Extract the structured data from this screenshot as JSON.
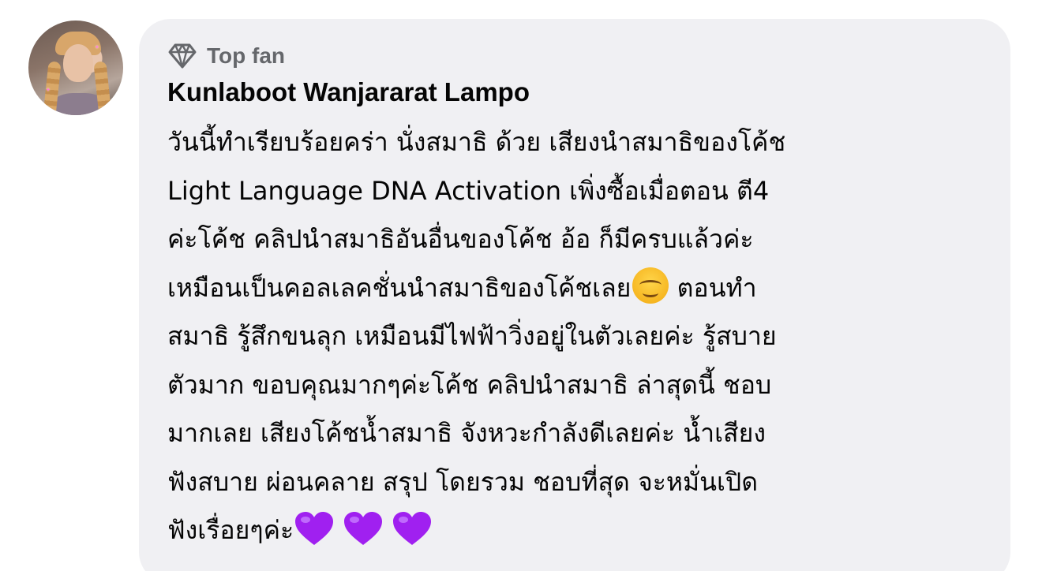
{
  "comment": {
    "badge_label": "Top fan",
    "author_name": "Kunlaboot Wanjararat Lampo",
    "lines": [
      "วันนี้ทำเรียบร้อยคร่า นั่งสมาธิ ด้วย เสียงนำสมาธิของโค้ช",
      "Light Language DNA Activation เพิ่งซื้อเมื่อตอน ตี4",
      "ค่ะโค้ช คลิปนำสมาธิอันอื่นของโค้ช อ้อ ก็มีครบแล้วค่ะ",
      "เหมือนเป็นคอลเลคชั่นนำสมาธิของโค้ชเลย",
      "ตอนทำ",
      "สมาธิ รู้สึกขนลุก เหมือนมีไฟฟ้าวิ่งอยู่ในตัวเลยค่ะ รู้สบาย",
      "ตัวมาก ขอบคุณมากๆค่ะโค้ช คลิปนำสมาธิ ล่าสุดนี้ ชอบ",
      "มากเลย เสียงโค้ชน้ำสมาธิ จังหวะกำลังดีเลยค่ะ น้ำเสียง",
      "ฟังสบาย ผ่อนคลาย สรุป โดยรวม ชอบที่สุด จะหมั่นเปิด",
      "ฟังเรื่อยๆค่ะ"
    ],
    "emojis": [
      "smiling-face",
      "purple-heart",
      "purple-heart",
      "purple-heart"
    ]
  },
  "colors": {
    "bubble_bg": "#f0f0f3",
    "badge_gray": "#65676b",
    "text": "#050505",
    "heart_purple": "#a020f0"
  }
}
